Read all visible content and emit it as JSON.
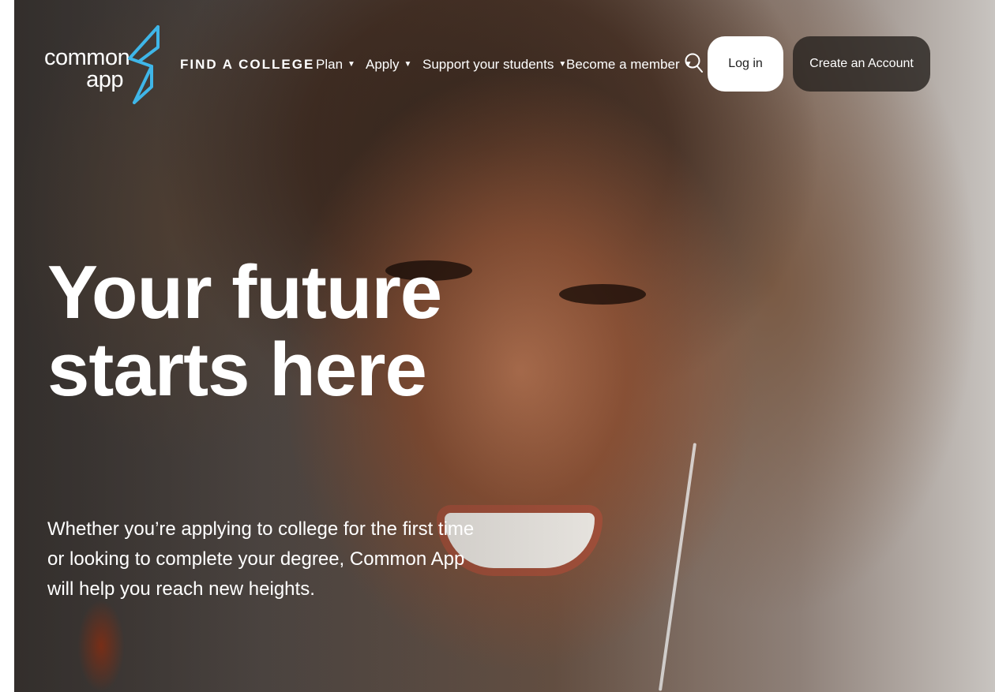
{
  "logo": {
    "line1": "common",
    "line2": "app"
  },
  "header": {
    "find_college": "FIND A COLLEGE",
    "nav_items": [
      {
        "label": "Plan"
      },
      {
        "label": "Apply"
      },
      {
        "label": "Support your students"
      },
      {
        "label": "Become a member"
      }
    ],
    "caret": "▼",
    "login_label": "Log in",
    "create_account_label": "Create an Account"
  },
  "hero": {
    "title_line1": "Your future",
    "title_line2": "starts here",
    "subtitle": "Whether you’re applying to college for the first time or looking to complete your degree, Common App will help you reach new heights."
  },
  "colors": {
    "logo_accent": "#3fb6e8",
    "text": "#ffffff",
    "login_bg": "#ffffff",
    "create_bg": "#282320"
  },
  "icons": {
    "search": "search-icon",
    "logo": "common-app-logo-icon"
  }
}
